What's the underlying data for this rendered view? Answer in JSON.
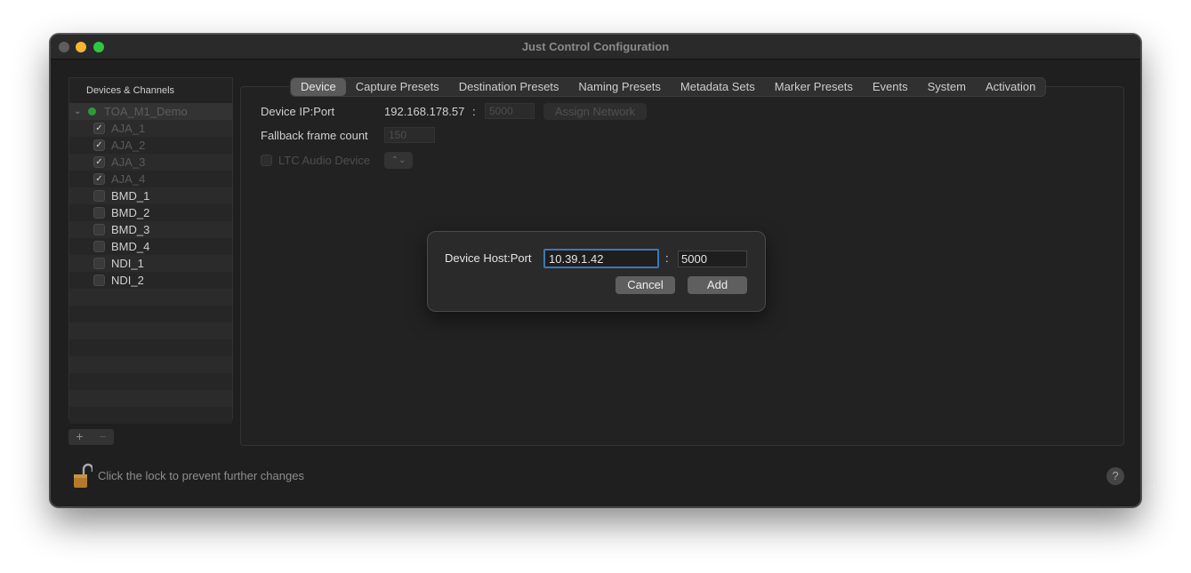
{
  "window": {
    "title": "Just Control Configuration"
  },
  "sidebar": {
    "header": "Devices & Channels",
    "device": {
      "label": "TOA_M1_Demo",
      "status": "online"
    },
    "channels": [
      {
        "label": "AJA_1",
        "checked": true
      },
      {
        "label": "AJA_2",
        "checked": true
      },
      {
        "label": "AJA_3",
        "checked": true
      },
      {
        "label": "AJA_4",
        "checked": true
      },
      {
        "label": "BMD_1",
        "checked": false
      },
      {
        "label": "BMD_2",
        "checked": false
      },
      {
        "label": "BMD_3",
        "checked": false
      },
      {
        "label": "BMD_4",
        "checked": false
      },
      {
        "label": "NDI_1",
        "checked": false
      },
      {
        "label": "NDI_2",
        "checked": false
      }
    ],
    "add_label": "+",
    "remove_label": "−"
  },
  "tabs": [
    "Device",
    "Capture Presets",
    "Destination Presets",
    "Naming Presets",
    "Metadata Sets",
    "Marker Presets",
    "Events",
    "System",
    "Activation"
  ],
  "active_tab": "Device",
  "device_panel": {
    "ip_port_label": "Device IP:Port",
    "ip_value": "192.168.178.57",
    "colon": ":",
    "port_value": "5000",
    "assign_network_label": "Assign Network",
    "fallback_label": "Fallback frame count",
    "fallback_value": "150",
    "ltc_label": "LTC Audio Device",
    "ltc_checked": false
  },
  "dialog": {
    "label": "Device Host:Port",
    "host_value": "10.39.1.42",
    "colon": ":",
    "port_value": "5000",
    "cancel_label": "Cancel",
    "add_label": "Add"
  },
  "footer": {
    "lock_text": "Click the lock to prevent further changes",
    "help_label": "?"
  },
  "colors": {
    "accent_focus": "#3a79b6",
    "status_green": "#2c9a36",
    "traffic_yellow": "#f5b82a",
    "traffic_green": "#2cc840"
  }
}
